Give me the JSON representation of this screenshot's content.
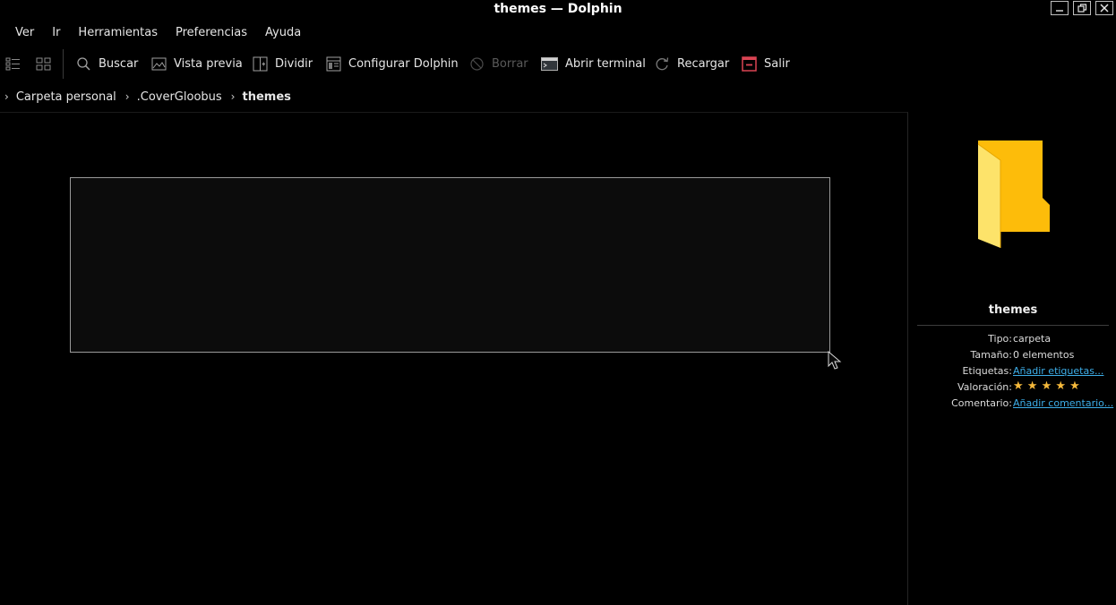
{
  "window": {
    "title_folder": "themes",
    "title_sep": "—",
    "title_app": "Dolphin"
  },
  "menubar": {
    "items": [
      "Ver",
      "Ir",
      "Herramientas",
      "Preferencias",
      "Ayuda"
    ]
  },
  "toolbar": {
    "buscar": "Buscar",
    "vista_previa": "Vista previa",
    "dividir": "Dividir",
    "configurar": "Configurar Dolphin",
    "borrar": "Borrar",
    "terminal": "Abrir terminal",
    "recargar": "Recargar",
    "salir": "Salir"
  },
  "breadcrumb": {
    "items": [
      "Carpeta personal",
      ".CoverGloobus",
      "themes"
    ]
  },
  "info_panel": {
    "name": "themes",
    "rows": [
      {
        "key": "Tipo:",
        "value": "carpeta"
      },
      {
        "key": "Tamaño:",
        "value": "0 elementos"
      },
      {
        "key": "Etiquetas:",
        "value": "Añadir etiquetas..."
      },
      {
        "key": "Valoración:",
        "value": "★ ★ ★ ★ ★",
        "rating": 5,
        "max_rating": 5
      },
      {
        "key": "Comentario:",
        "value": "Añadir comentario..."
      }
    ]
  },
  "colors": {
    "background": "#000000",
    "link": "#3daee9",
    "star": "#f6b93b",
    "folder": "#fdbc0a",
    "exit_icon": "#da4453"
  }
}
